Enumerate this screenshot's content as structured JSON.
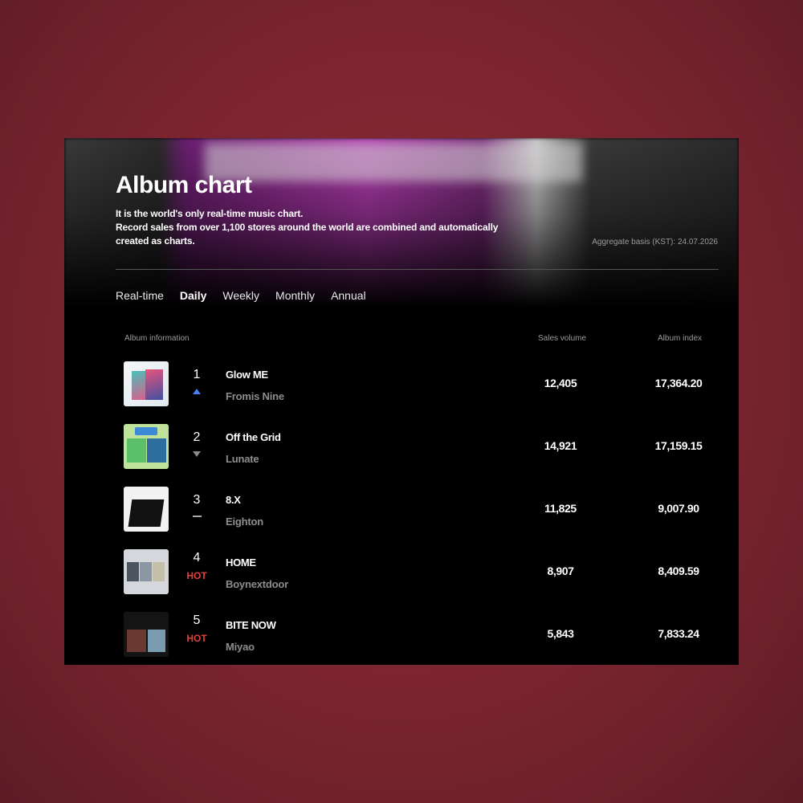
{
  "header": {
    "title": "Album chart",
    "description_line1": "It is the world's only real-time music chart.",
    "description_line2": "Record sales from over 1,100 stores around the world are combined and automatically created as charts.",
    "aggregate_basis": "Aggregate basis (KST): 24.07.2026"
  },
  "tabs": [
    "Real-time",
    "Daily",
    "Weekly",
    "Monthly",
    "Annual"
  ],
  "active_tab": "Daily",
  "columns": {
    "album_info": "Album information",
    "sales_volume": "Sales volume",
    "album_index": "Album index"
  },
  "rows": [
    {
      "rank": "1",
      "change": "up",
      "change_label": "",
      "album": "Glow ME",
      "artist": "Fromis Nine",
      "sales": "12,405",
      "index": "17,364.20"
    },
    {
      "rank": "2",
      "change": "down",
      "change_label": "",
      "album": "Off the Grid",
      "artist": "Lunate",
      "sales": "14,921",
      "index": "17,159.15"
    },
    {
      "rank": "3",
      "change": "same",
      "change_label": "",
      "album": "8.X",
      "artist": "Eighton",
      "sales": "11,825",
      "index": "9,007.90"
    },
    {
      "rank": "4",
      "change": "hot",
      "change_label": "HOT",
      "album": "HOME",
      "artist": "Boynextdoor",
      "sales": "8,907",
      "index": "8,409.59"
    },
    {
      "rank": "5",
      "change": "hot",
      "change_label": "HOT",
      "album": "BITE NOW",
      "artist": "Miyao",
      "sales": "5,843",
      "index": "7,833.24"
    }
  ],
  "colors": {
    "hot": "#e0413a",
    "up": "#4a7df0",
    "down": "#8a8a8a",
    "background": "#7a2430"
  }
}
